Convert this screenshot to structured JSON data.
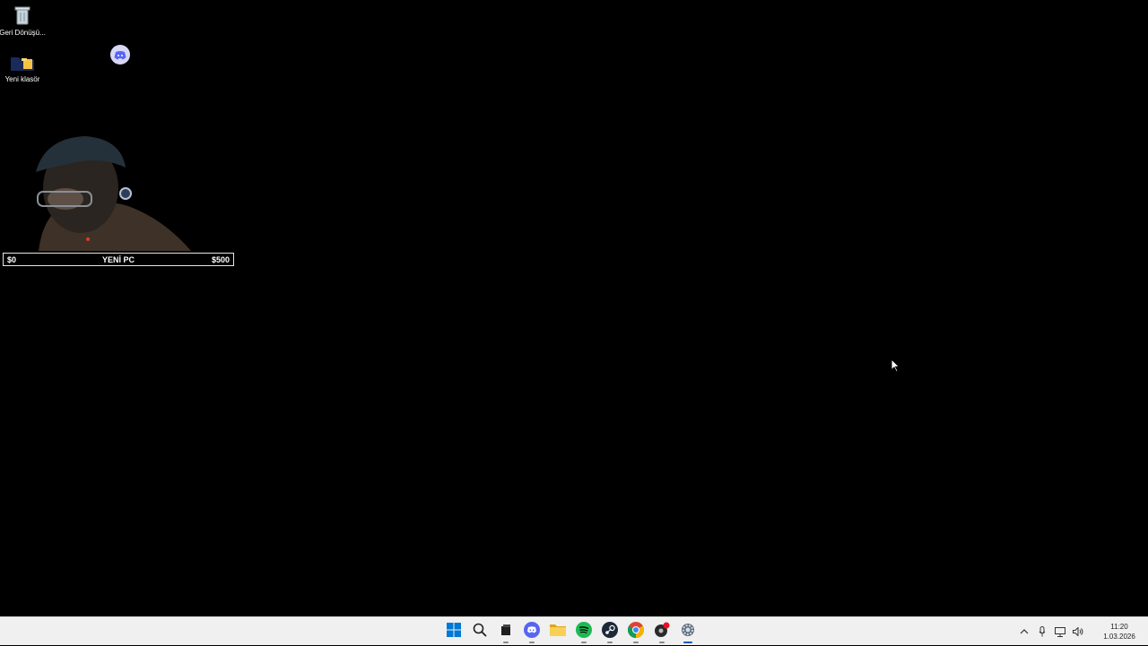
{
  "desktop": {
    "icons": [
      {
        "label": "Geri Dönüşü...",
        "icon": "recycle-bin-icon"
      },
      {
        "label": "Yeni klasör",
        "icon": "folder-icon"
      }
    ],
    "floating_icon": "discord-icon"
  },
  "overlay": {
    "goal_left": "$0",
    "goal_title": "YENİ PC",
    "goal_right": "$500"
  },
  "taskbar": {
    "apps": [
      {
        "name": "start",
        "icon": "windows-start-icon"
      },
      {
        "name": "search",
        "icon": "search-icon"
      },
      {
        "name": "obs",
        "icon": "obs-icon"
      },
      {
        "name": "discord",
        "icon": "discord-icon"
      },
      {
        "name": "file-explorer",
        "icon": "folder-icon"
      },
      {
        "name": "spotify",
        "icon": "spotify-icon"
      },
      {
        "name": "steam",
        "icon": "steam-icon"
      },
      {
        "name": "chrome",
        "icon": "chrome-icon"
      },
      {
        "name": "obs-recording",
        "icon": "record-icon"
      },
      {
        "name": "settings",
        "icon": "gear-icon"
      }
    ],
    "time": "11:20",
    "date": "1.03.2026"
  },
  "colors": {
    "desktop_bg": "#000000",
    "taskbar_bg": "#f0f0f0",
    "accent": "#005fb8",
    "discord": "#5865f2",
    "spotify": "#1db954"
  }
}
